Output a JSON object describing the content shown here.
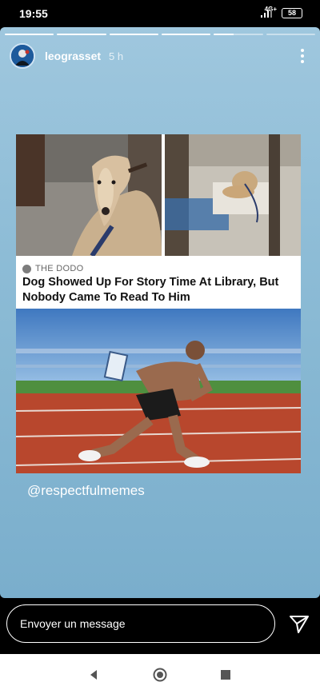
{
  "status_bar": {
    "time": "19:55",
    "network": "4G+",
    "battery": "58"
  },
  "story": {
    "username": "leograsset",
    "time_ago": "5 h",
    "progress": [
      1,
      1,
      1,
      1,
      0.4,
      0
    ],
    "post": {
      "source": "THE DODO",
      "headline": "Dog Showed Up For Story Time At Library, But Nobody Came To Read To Him"
    },
    "mention": "@respectfulmemes"
  },
  "composer": {
    "placeholder": "Envoyer un message"
  },
  "icons": {
    "more": "more-vertical-icon",
    "send": "send-icon",
    "back": "back-triangle-icon",
    "home": "home-circle-icon",
    "recents": "recents-square-icon"
  },
  "colors": {
    "story_bg": "#8dbcd6",
    "track": "#b8472d",
    "sky": "#4f86c6"
  }
}
